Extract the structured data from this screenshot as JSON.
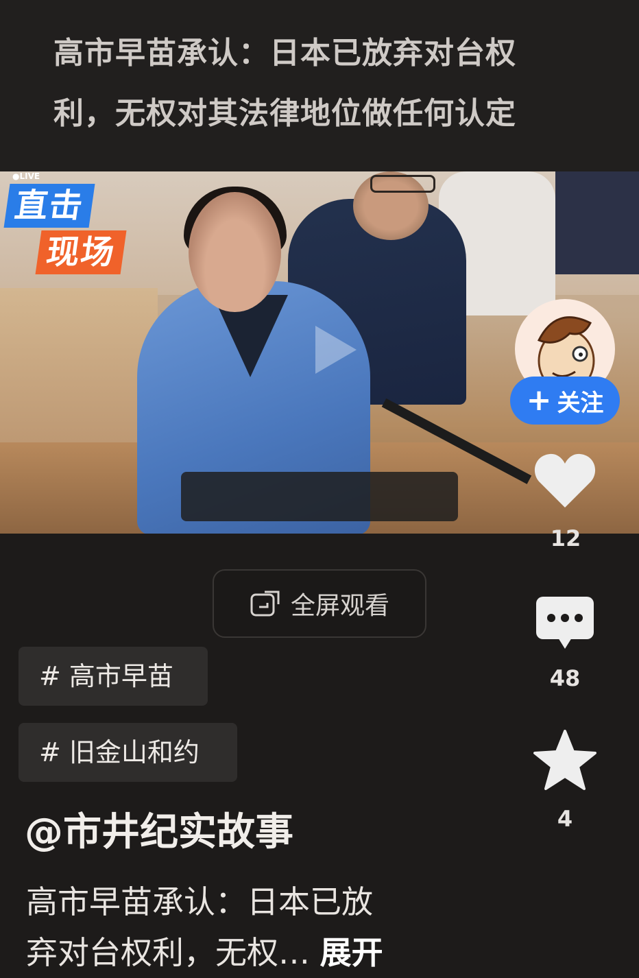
{
  "headline": {
    "line1": "高市早苗承认：日本已放弃对台权",
    "line2": "利，无权对其法律地位做任何认定"
  },
  "video": {
    "live_label": "●LIVE",
    "badge_line1": "直击",
    "badge_line2": "现场"
  },
  "side_actions": {
    "follow_label": "关注",
    "likes": "12",
    "comments": "48",
    "favorites": "4"
  },
  "fullscreen": {
    "label": "全屏观看"
  },
  "tags": [
    "# 高市早苗",
    "# 旧金山和约"
  ],
  "author": "@市井纪实故事",
  "description": {
    "line1": "高市早苗承认：日本已放",
    "line2": "弃对台权利，无权…",
    "expand": "展开"
  },
  "colors": {
    "accent_blue": "#2f7cf2",
    "badge_blue": "#2a7de8",
    "badge_orange": "#f0622a",
    "background": "#1d1b1a"
  },
  "icons": [
    "play-icon",
    "plus-icon",
    "heart-icon",
    "comment-icon",
    "star-icon",
    "fullscreen-icon"
  ]
}
